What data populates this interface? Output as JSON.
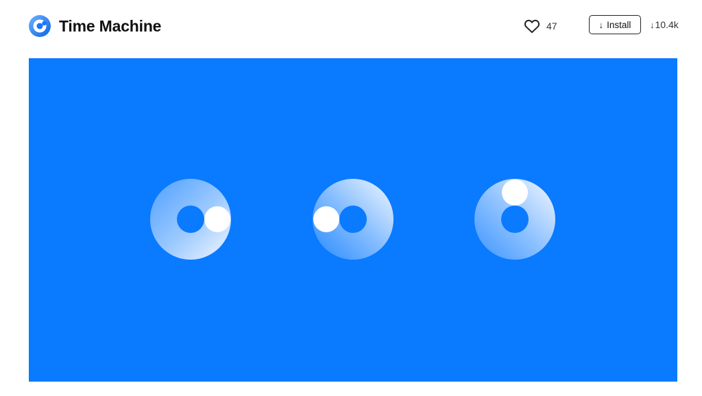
{
  "app": {
    "title": "Time Machine",
    "logo_icon": "time-machine-logo-icon"
  },
  "actions": {
    "like_icon": "heart-icon",
    "like_count": "47",
    "install_icon": "arrow-down-icon",
    "install_label": "Install",
    "download_icon": "arrow-down-icon",
    "downloads": "10.4k"
  },
  "preview": {
    "background_color": "#0a7aff",
    "icons": [
      "loading-ring-icon",
      "loading-ring-icon",
      "loading-ring-icon"
    ]
  },
  "colors": {
    "accent": "#0a7aff",
    "logo_blue": "#1a74ff"
  }
}
